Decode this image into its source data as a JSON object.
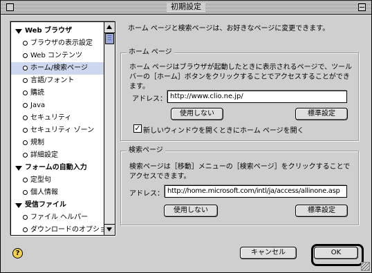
{
  "window": {
    "title": "初期設定"
  },
  "sidebar": {
    "items": [
      {
        "type": "category",
        "label": "Web ブラウザ"
      },
      {
        "type": "item",
        "label": "ブラウザの表示設定"
      },
      {
        "type": "item",
        "label": "Web コンテンツ"
      },
      {
        "type": "item",
        "label": "ホーム/検索ページ",
        "selected": true
      },
      {
        "type": "item",
        "label": "言語/フォント"
      },
      {
        "type": "item",
        "label": "購読"
      },
      {
        "type": "item",
        "label": "Java"
      },
      {
        "type": "item",
        "label": "セキュリティ"
      },
      {
        "type": "item",
        "label": "セキュリティ ゾーン"
      },
      {
        "type": "item",
        "label": "規制"
      },
      {
        "type": "item",
        "label": "詳細設定"
      },
      {
        "type": "category",
        "label": "フォームの自動入力"
      },
      {
        "type": "item",
        "label": "定型句"
      },
      {
        "type": "item",
        "label": "個人情報"
      },
      {
        "type": "category",
        "label": "受信ファイル"
      },
      {
        "type": "item",
        "label": "ファイル ヘルパー"
      },
      {
        "type": "item",
        "label": "ダウンロードのオプション"
      }
    ]
  },
  "main": {
    "intro": "ホーム ページと検索ページは、お好きなページに変更できます。",
    "home": {
      "legend": "ホーム ページ",
      "desc": [
        "ホーム ページはブラウザが起動したときに表示されるページで、ツール",
        "バーの［ホーム］ボタンをクリックすることでアクセスすることができ",
        "ます。"
      ],
      "address_label": "アドレス：",
      "address_value": "http://www.clio.ne.jp/",
      "btn_none": "使用しない",
      "btn_default": "標準設定",
      "checkbox_label": "新しいウィンドウを開くときにホーム ページを開く",
      "checkbox_checked": true
    },
    "search": {
      "legend": "検索ページ",
      "desc": [
        "検索ページは［移動］メニューの［検索ページ］をクリックすることで",
        "アクセスできます。"
      ],
      "address_label": "アドレス：",
      "address_value": "http://home.microsoft.com/intl/ja/access/allinone.asp",
      "btn_none": "使用しない",
      "btn_default": "標準設定"
    }
  },
  "footer": {
    "help": "?",
    "cancel": "キャンセル",
    "ok": "OK"
  }
}
